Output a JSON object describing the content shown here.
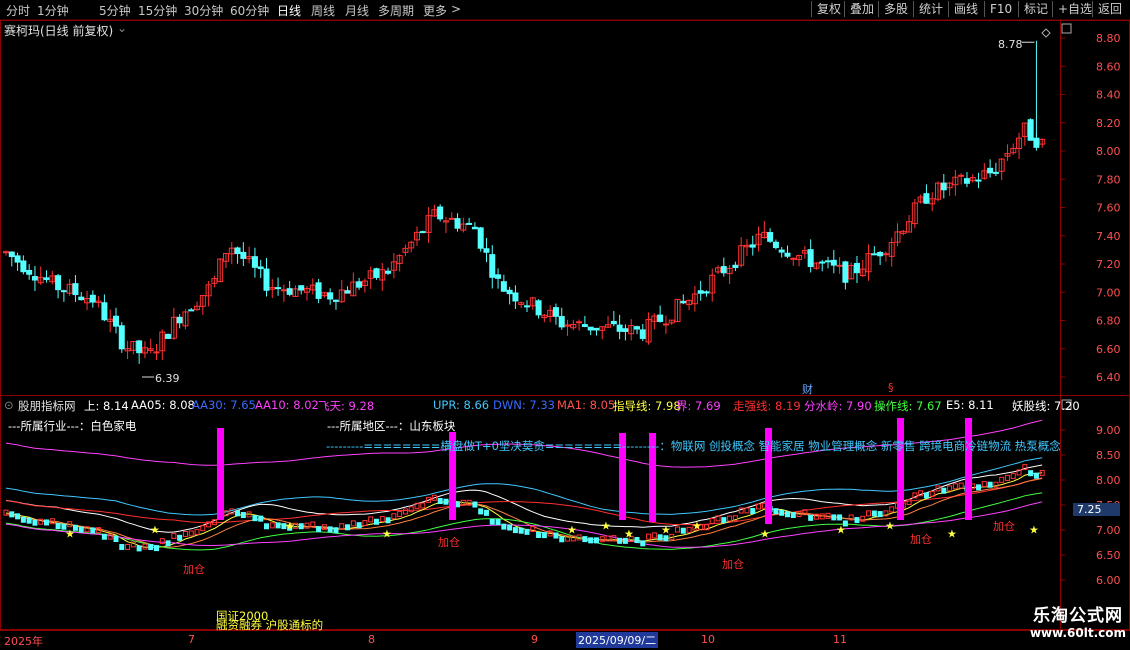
{
  "toolbar": {
    "periods": [
      "分时",
      "1分钟",
      "5分钟",
      "15分钟",
      "30分钟",
      "60分钟",
      "日线",
      "周线",
      "月线",
      "多周期",
      "更多"
    ],
    "active_period": "日线",
    "more_arrow": ">",
    "right_buttons": [
      "复权",
      "叠加",
      "多股",
      "统计",
      "画线",
      "F10",
      "标记",
      "+自选",
      "返回"
    ]
  },
  "main_chart": {
    "title": "赛柯玛(日线 前复权)",
    "high_label": "8.78",
    "low_label": "6.39",
    "y_ticks": [
      "8.80",
      "8.60",
      "8.40",
      "8.20",
      "8.00",
      "7.80",
      "7.60",
      "7.40",
      "7.20",
      "7.00",
      "6.80",
      "6.60",
      "6.40"
    ],
    "markers": {
      "cai": "财",
      "fu": "§"
    }
  },
  "indicator": {
    "name": "股朋指标网",
    "values": [
      {
        "text": "上: 8.14",
        "color": "#ffffff"
      },
      {
        "text": "AA05: 8.08",
        "color": "#ffffff"
      },
      {
        "text": "AA30: 7.65",
        "color": "#3b6bff"
      },
      {
        "text": "AA10: 8.02",
        "color": "#ff40ff"
      },
      {
        "text": "飞天: 9.28",
        "color": "#ff40ff"
      },
      {
        "text": "UPR: 8.66",
        "color": "#40c8ff"
      },
      {
        "text": "DWN: 7.33",
        "color": "#3b6bff"
      },
      {
        "text": "MA1: 8.05",
        "color": "#ff5050"
      },
      {
        "text": "指导线: 7.98",
        "color": "#ffff40"
      },
      {
        "text": "界: 7.69",
        "color": "#ff40ff"
      },
      {
        "text": "走强线: 8.19",
        "color": "#ff3030"
      },
      {
        "text": "分水岭: 7.90",
        "color": "#ff40ff"
      },
      {
        "text": "操作线: 7.67",
        "color": "#40ff40"
      },
      {
        "text": "E5: 8.11",
        "color": "#ffffff"
      },
      {
        "text": "妖股线: 7.20",
        "color": "#ffffff"
      }
    ],
    "industry_label": "---所属行业---：白色家电",
    "region_label": "---所属地区---：山东板块",
    "concept_line": "---------========横盘做T+0坚决莫贪========---------：物联网 创投概念 智能家居 物业管理概念 新零售 跨境电商冷链物流 热泵概念",
    "y_ticks": [
      "9.00",
      "8.50",
      "8.00",
      "7.50",
      "7.00",
      "6.50",
      "6.00"
    ],
    "current_value": "7.25",
    "add_label": "加仓",
    "bottom_texts": [
      "国证2000",
      "融资融券 沪股通标的"
    ]
  },
  "date_axis": {
    "labels": [
      "2025年",
      "7",
      "8",
      "9",
      "2025/09/09/二",
      "10",
      "11"
    ]
  },
  "watermark": {
    "line1": "乐淘公式网",
    "line2": "www.60lt.com"
  },
  "colors": {
    "up": "#ff3232",
    "down": "#54ffff",
    "border": "#8b0000",
    "grid": "#5a0000"
  }
}
